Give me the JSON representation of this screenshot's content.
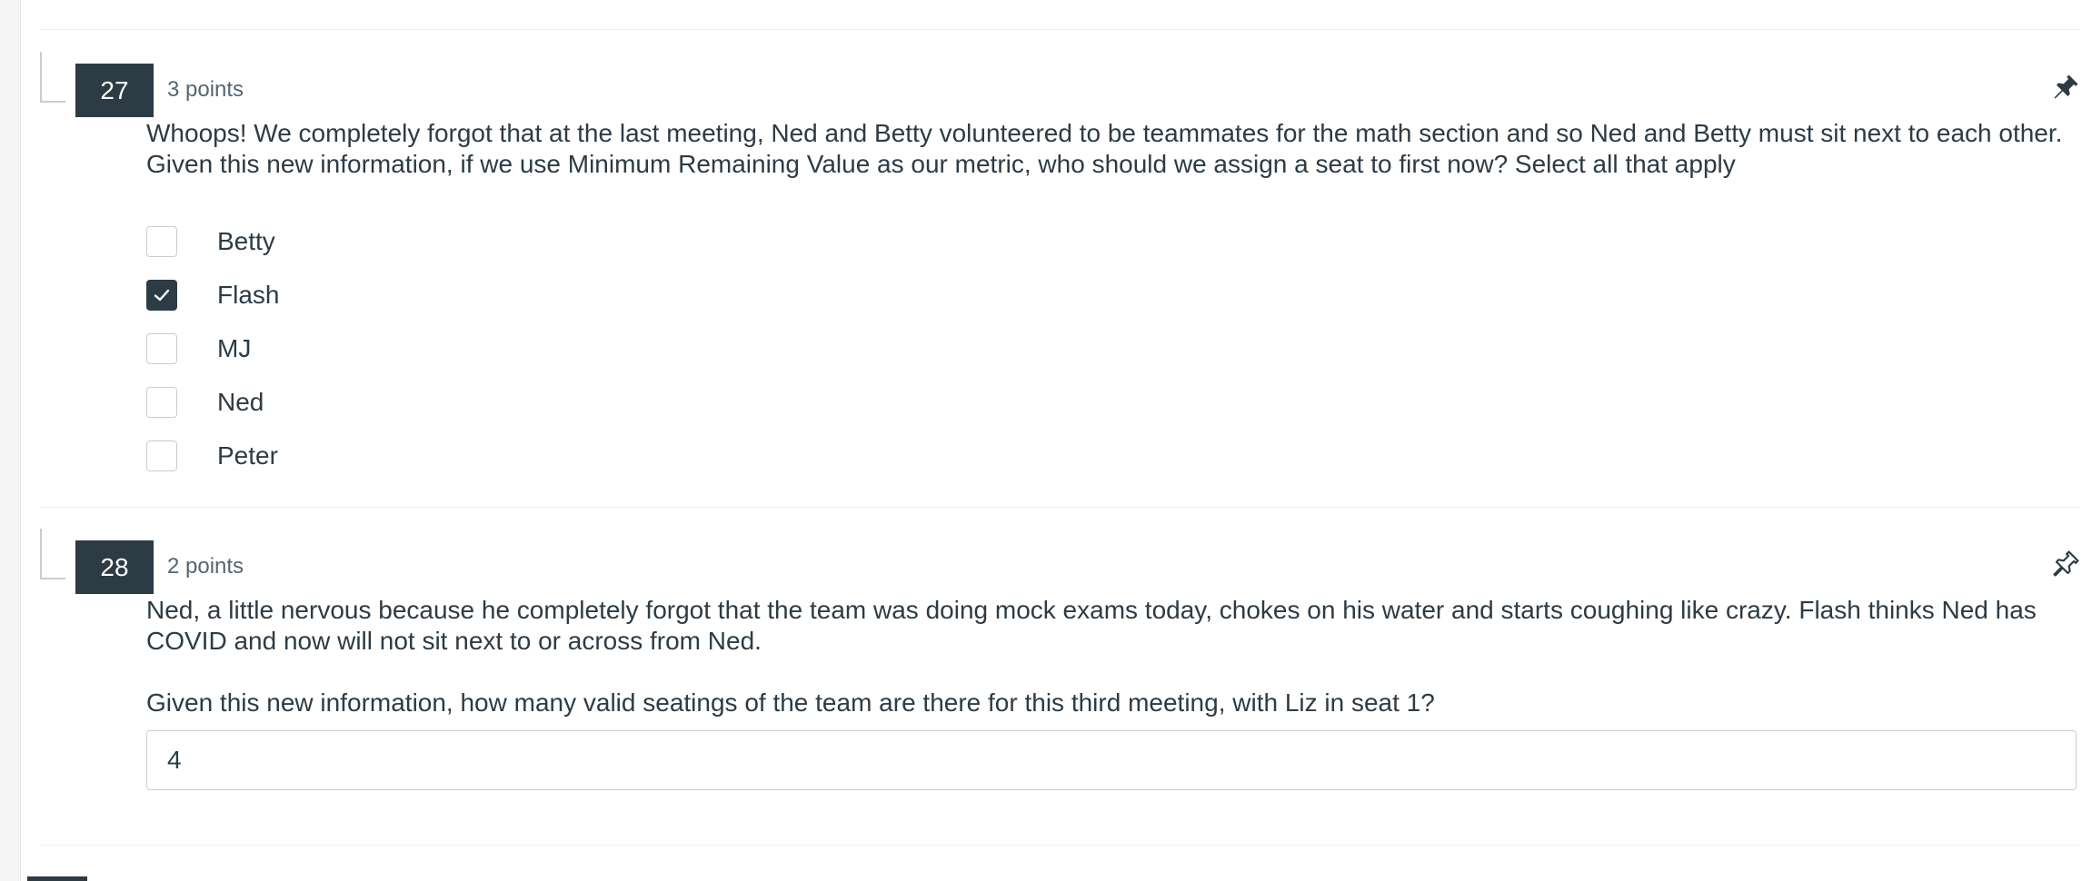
{
  "questions": [
    {
      "number": "27",
      "points": "3 points",
      "text_lines": [
        "Whoops! We completely forgot that at the last meeting, Ned and Betty volunteered to be teammates for the math section and so Ned and Betty must sit next to each other.",
        "Given this new information, if we use Minimum Remaining Value as our metric, who should we assign a seat to first now? Select all that apply"
      ],
      "pinned": true,
      "answers": [
        {
          "label": "Betty",
          "checked": false
        },
        {
          "label": "Flash",
          "checked": true
        },
        {
          "label": "MJ",
          "checked": false
        },
        {
          "label": "Ned",
          "checked": false
        },
        {
          "label": "Peter",
          "checked": false
        }
      ]
    },
    {
      "number": "28",
      "points": "2 points",
      "text_lines": [
        "Ned, a little nervous because he completely forgot that the team was doing mock exams today, chokes on his water and starts coughing like crazy. Flash thinks Ned has COVID and now will not sit next to or across from Ned.",
        "Given this new information, how many valid seatings of the team are there for this third meeting, with Liz in seat 1?"
      ],
      "pinned": false,
      "answer_value": "4"
    }
  ],
  "icons": {
    "pin_filled": "pin-icon",
    "pin_outline": "pin-outline-icon",
    "check": "check-icon"
  },
  "colors": {
    "accent_dark": "#2d3b45",
    "border": "#c7cdd1",
    "muted_text": "#556572"
  }
}
